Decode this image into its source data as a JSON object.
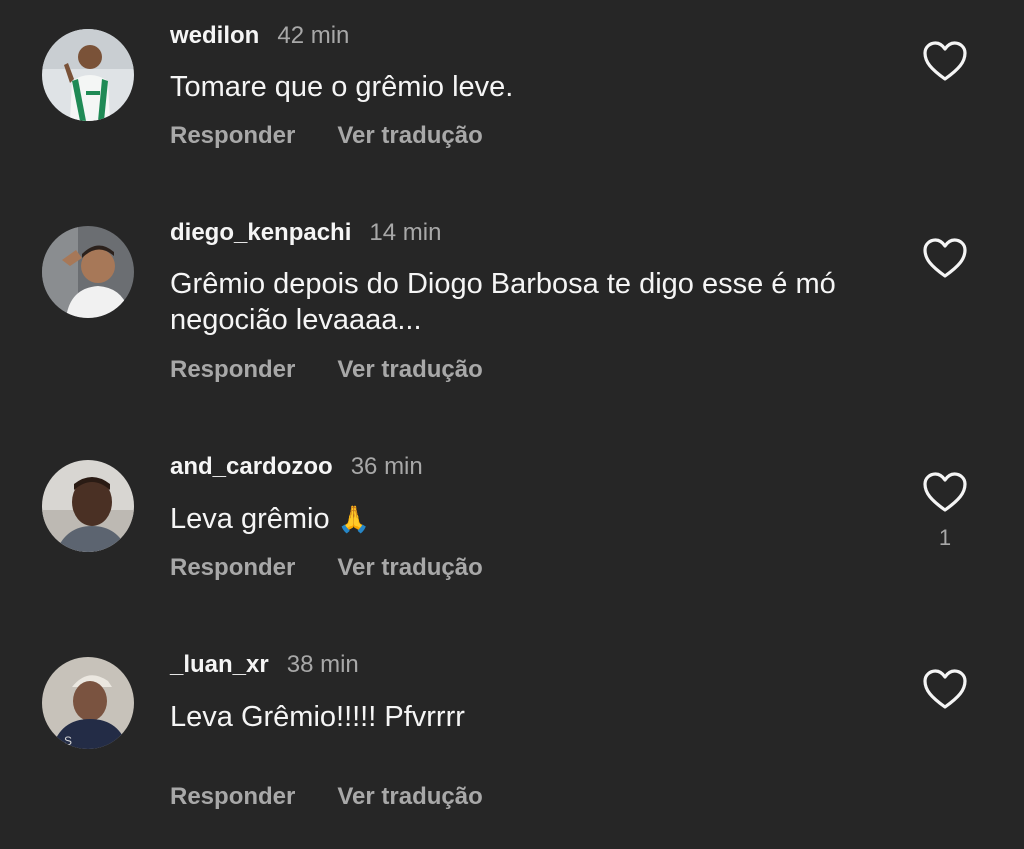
{
  "colors": {
    "background": "#262626",
    "primary_text": "#f5f5f5",
    "secondary_text": "#a8a8a8"
  },
  "comments": [
    {
      "username": "wedilon",
      "time": "42 min",
      "text": "Tomare que o grêmio leve.",
      "reply_label": "Responder",
      "translate_label": "Ver tradução",
      "like_icon": "heart-outline-icon",
      "like_count": ""
    },
    {
      "username": "diego_kenpachi",
      "time": "14 min",
      "text": "Grêmio depois do Diogo Barbosa te digo esse é mó negocião levaaaa...",
      "reply_label": "Responder",
      "translate_label": "Ver tradução",
      "like_icon": "heart-outline-icon",
      "like_count": ""
    },
    {
      "username": "and_cardozoo",
      "time": "36 min",
      "text": "Leva grêmio",
      "emoji": "🙏",
      "reply_label": "Responder",
      "translate_label": "Ver tradução",
      "like_icon": "heart-outline-icon",
      "like_count": "1"
    },
    {
      "username": "_luan_xr",
      "time": "38 min",
      "text": "Leva Grêmio!!!!! Pfvrrrr",
      "reply_label": "Responder",
      "translate_label": "Ver tradução",
      "like_icon": "heart-outline-icon",
      "like_count": ""
    }
  ]
}
